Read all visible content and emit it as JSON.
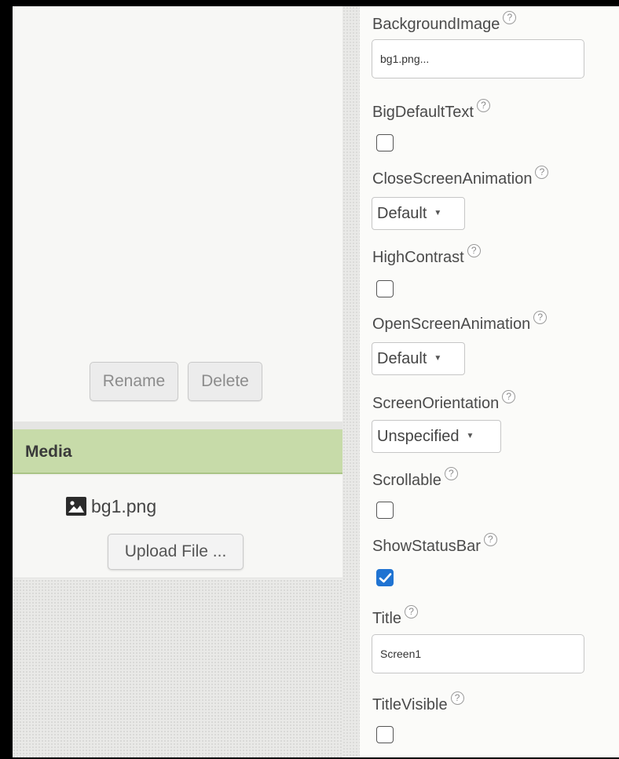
{
  "file_buttons": {
    "rename_label": "Rename",
    "delete_label": "Delete"
  },
  "media": {
    "header": "Media",
    "files": [
      {
        "name": "bg1.png",
        "icon": "image-icon"
      }
    ],
    "upload_label": "Upload File ..."
  },
  "properties": {
    "background_image": {
      "label": "BackgroundImage",
      "value": "bg1.png..."
    },
    "big_default_text": {
      "label": "BigDefaultText",
      "checked": false
    },
    "close_screen_animation": {
      "label": "CloseScreenAnimation",
      "value": "Default"
    },
    "high_contrast": {
      "label": "HighContrast",
      "checked": false
    },
    "open_screen_animation": {
      "label": "OpenScreenAnimation",
      "value": "Default"
    },
    "screen_orientation": {
      "label": "ScreenOrientation",
      "value": "Unspecified"
    },
    "scrollable": {
      "label": "Scrollable",
      "checked": false
    },
    "show_status_bar": {
      "label": "ShowStatusBar",
      "checked": true
    },
    "title": {
      "label": "Title",
      "value": "Screen1"
    },
    "title_visible": {
      "label": "TitleVisible",
      "checked": false
    }
  },
  "help_glyph": "?",
  "dropdown_caret": "▼",
  "colors": {
    "media_header_bg": "#c7dba9",
    "checkbox_checked": "#1f73d2"
  }
}
